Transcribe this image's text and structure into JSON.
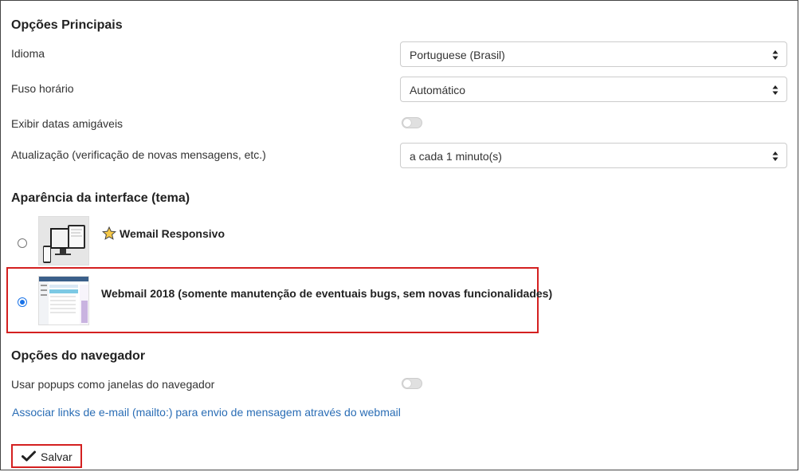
{
  "main_options": {
    "heading": "Opções Principais",
    "language": {
      "label": "Idioma",
      "value": "Portuguese (Brasil)"
    },
    "timezone": {
      "label": "Fuso horário",
      "value": "Automático"
    },
    "friendly_dates": {
      "label": "Exibir datas amigáveis",
      "enabled": false
    },
    "refresh": {
      "label": "Atualização (verificação de novas mensagens, etc.)",
      "value": "a cada 1 minuto(s)"
    }
  },
  "theme": {
    "heading": "Aparência da interface (tema)",
    "options": [
      {
        "name": "Wemail Responsivo",
        "selected": false,
        "icon": "star-icon"
      },
      {
        "name": "Webmail 2018 (somente manutenção de eventuais bugs, sem novas funcionalidades)",
        "selected": true
      }
    ]
  },
  "browser_options": {
    "heading": "Opções do navegador",
    "popups": {
      "label": "Usar popups como janelas do navegador",
      "enabled": false
    },
    "mailto_link": "Associar links de e-mail (mailto:) para envio de mensagem através do webmail"
  },
  "save_button": {
    "label": "Salvar",
    "icon": "checkmark-icon"
  },
  "colors": {
    "accent": "#1a73e8",
    "highlight": "#d42020",
    "link": "#2a6db5"
  }
}
